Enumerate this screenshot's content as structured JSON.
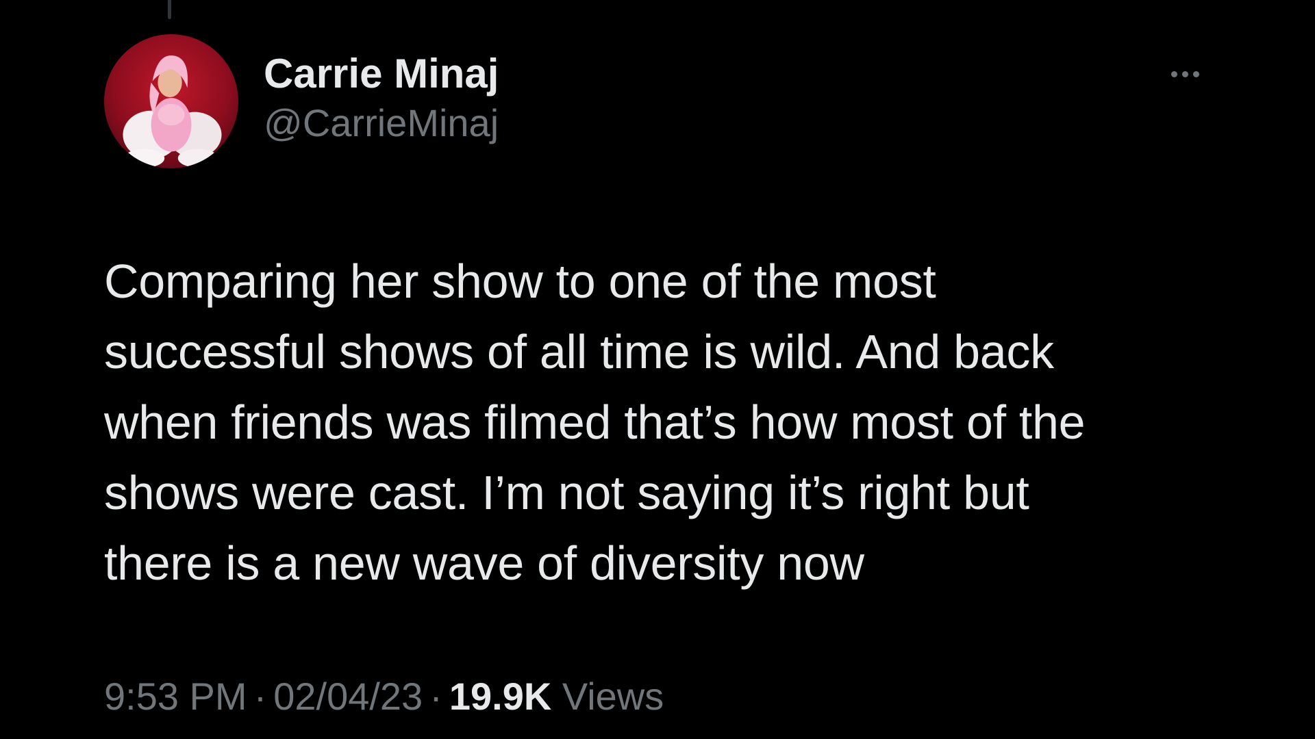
{
  "tweet": {
    "author": {
      "display_name": "Carrie Minaj",
      "handle": "@CarrieMinaj"
    },
    "text": "Comparing her show to one of the most\nsuccessful shows of all time is wild. And back\nwhen friends was filmed that’s how most of the\nshows were cast. I’m not saying it’s right but\nthere is a new wave of diversity now",
    "time": "9:53 PM",
    "separator": "·",
    "date": "02/04/23",
    "views_count": "19.9K",
    "views_label": "Views",
    "more_icon": "more-horizontal-icon"
  },
  "colors": {
    "background": "#000000",
    "primary_text": "#e7e9ea",
    "secondary_text": "#71767b"
  }
}
